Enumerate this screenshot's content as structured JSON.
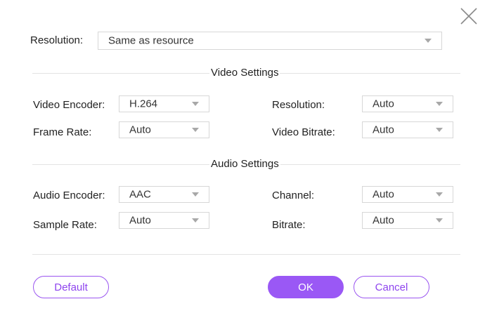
{
  "top": {
    "resolution_label": "Resolution:",
    "resolution_value": "Same as resource"
  },
  "video": {
    "title": "Video Settings",
    "encoder_label": "Video Encoder:",
    "encoder_value": "H.264",
    "frame_rate_label": "Frame Rate:",
    "frame_rate_value": "Auto",
    "resolution_label": "Resolution:",
    "resolution_value": "Auto",
    "bitrate_label": "Video Bitrate:",
    "bitrate_value": "Auto"
  },
  "audio": {
    "title": "Audio Settings",
    "encoder_label": "Audio Encoder:",
    "encoder_value": "AAC",
    "sample_rate_label": "Sample Rate:",
    "sample_rate_value": "Auto",
    "channel_label": "Channel:",
    "channel_value": "Auto",
    "bitrate_label": "Bitrate:",
    "bitrate_value": "Auto"
  },
  "buttons": {
    "default_label": "Default",
    "ok_label": "OK",
    "cancel_label": "Cancel"
  },
  "colors": {
    "accent": "#9a58f5",
    "accent_text": "#8e44ee",
    "border": "#d7d7d7",
    "divider": "#e3e3e3"
  },
  "icons": {
    "close": "close-icon",
    "dropdown": "chevron-down-icon"
  }
}
